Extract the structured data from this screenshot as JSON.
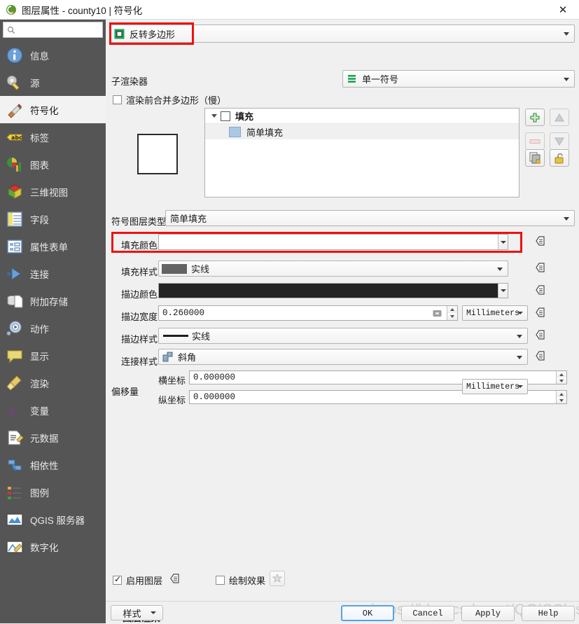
{
  "window": {
    "title": "图层属性 - county10 | 符号化",
    "app_icon": "qgis-logo-icon",
    "close_label": "✕"
  },
  "sidebar": {
    "search": {
      "placeholder": "",
      "value": "",
      "icon": "search-icon"
    },
    "items": [
      {
        "label": "信息",
        "icon": "information-icon",
        "active": false
      },
      {
        "label": "源",
        "icon": "wrench-icon",
        "active": false
      },
      {
        "label": "符号化",
        "icon": "paintbrush-icon",
        "active": true
      },
      {
        "label": "标签",
        "icon": "abc-label-icon",
        "active": false
      },
      {
        "label": "图表",
        "icon": "diagram-chart-icon",
        "active": false
      },
      {
        "label": "三维视图",
        "icon": "cube-3d-icon",
        "active": false
      },
      {
        "label": "字段",
        "icon": "table-fields-icon",
        "active": false
      },
      {
        "label": "属性表单",
        "icon": "attribute-form-icon",
        "active": false
      },
      {
        "label": "连接",
        "icon": "join-icon",
        "active": false
      },
      {
        "label": "附加存储",
        "icon": "auxiliary-storage-icon",
        "active": false
      },
      {
        "label": "动作",
        "icon": "action-gear-icon",
        "active": false
      },
      {
        "label": "显示",
        "icon": "display-speech-icon",
        "active": false
      },
      {
        "label": "渲染",
        "icon": "rendering-broom-icon",
        "active": false
      },
      {
        "label": "变量",
        "icon": "variables-epsilon-icon",
        "active": false
      },
      {
        "label": "元数据",
        "icon": "metadata-icon",
        "active": false
      },
      {
        "label": "相依性",
        "icon": "dependencies-icon",
        "active": false
      },
      {
        "label": "图例",
        "icon": "legend-icon",
        "active": false
      },
      {
        "label": "QGIS 服务器",
        "icon": "qgis-server-icon",
        "active": false
      },
      {
        "label": "数字化",
        "icon": "digitizing-icon",
        "active": false
      }
    ]
  },
  "main": {
    "renderer_combo": {
      "label": "反转多边形",
      "icon": "inverted-polygon-icon",
      "highlighted": true,
      "highlight_color": "#ee1111"
    },
    "sub_renderer": {
      "label": "子渲染器",
      "value": "单一符号",
      "icon": "single-symbol-icon"
    },
    "merge_polygons": {
      "label": "渲染前合并多边形（慢）",
      "checked": false
    },
    "symbol_tree": {
      "rows": [
        {
          "label": "填充",
          "type": "group",
          "checked": false,
          "expanded": true,
          "selected": false
        },
        {
          "label": "简单填充",
          "type": "layer",
          "swatch": "#aac8e4",
          "selected": true
        }
      ]
    },
    "tree_buttons": [
      {
        "name": "add-symbol-layer-button",
        "icon": "plus-icon",
        "enabled": true
      },
      {
        "name": "move-up-button",
        "icon": "arrow-up-icon",
        "enabled": false
      },
      {
        "name": "remove-symbol-layer-button",
        "icon": "minus-icon",
        "enabled": false
      },
      {
        "name": "move-down-button",
        "icon": "arrow-down-icon",
        "enabled": false
      },
      {
        "name": "duplicate-symbol-layer-button",
        "icon": "duplicate-icon",
        "enabled": true
      },
      {
        "name": "lock-colors-button",
        "icon": "unlocked-padlock-icon",
        "enabled": true
      }
    ],
    "symbol_layer_type": {
      "label": "符号图层类型",
      "value": "简单填充"
    },
    "properties": {
      "fill_color": {
        "label": "填充颜色",
        "value": "#ffffff",
        "highlighted": true,
        "highlight_color": "#ee1111"
      },
      "fill_style": {
        "label": "填充样式",
        "value": "实线",
        "swatch": "#636363"
      },
      "stroke_color": {
        "label": "描边颜色",
        "value": "#232323"
      },
      "stroke_width": {
        "label": "描边宽度",
        "value": "0.260000",
        "unit": "Millimeters"
      },
      "stroke_style": {
        "label": "描边样式",
        "value": "实线"
      },
      "join_style": {
        "label": "连接样式",
        "value": "斜角",
        "icon": "join-bevel-icon"
      },
      "offset": {
        "label": "偏移量",
        "x_label": "横坐标",
        "x_value": "0.000000",
        "y_label": "纵坐标",
        "y_value": "0.000000",
        "unit": "Millimeters"
      }
    },
    "enable_layer": {
      "label": "启用图层",
      "checked": true
    },
    "draw_effects": {
      "label": "绘制效果",
      "checked": false,
      "button_icon": "star-effects-icon"
    },
    "layer_rendering": {
      "label": "图层渲染",
      "expanded": false
    }
  },
  "footer": {
    "style_button": "样式",
    "ok_button": "OK",
    "cancel_button": "Cancel",
    "apply_button": "Apply",
    "help_button": "Help"
  },
  "watermark": "https://blog.csdn.net/QGISClass"
}
